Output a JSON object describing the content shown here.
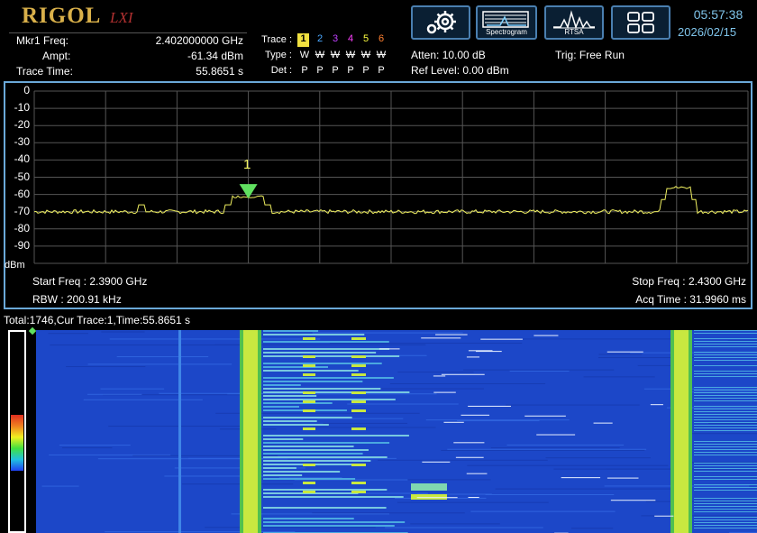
{
  "brand": {
    "logo": "RIGOL",
    "sublogo": "LXI"
  },
  "marker": {
    "freq_label": "Mkr1 Freq:",
    "freq_value": "2.402000000 GHz",
    "ampt_label": "Ampt:",
    "ampt_value": "-61.34 dBm",
    "time_label": "Trace Time:",
    "time_value": "55.8651 s"
  },
  "traces": {
    "trace_label": "Trace :",
    "type_label": "Type :",
    "det_label": "Det :",
    "numbers": [
      "1",
      "2",
      "3",
      "4",
      "5",
      "6"
    ],
    "number_colors": [
      "#000000",
      "#4aa8ff",
      "#c040ff",
      "#ff40ff",
      "#ffff40",
      "#ff8030"
    ],
    "types": [
      "W",
      "W",
      "W",
      "W",
      "W",
      "W"
    ],
    "dets": [
      "P",
      "P",
      "P",
      "P",
      "P",
      "P"
    ]
  },
  "settings": {
    "atten": "Atten: 10.00 dB",
    "ref_level": "Ref Level: 0.00 dBm",
    "trig": "Trig: Free Run"
  },
  "toolbar": {
    "spectrogram_label": "Spectrogram",
    "rtsa_label": "RTSA"
  },
  "clock": {
    "time": "05:57:38",
    "date": "2026/02/15"
  },
  "spectrum": {
    "y_ticks": [
      "0",
      "-10",
      "-20",
      "-30",
      "-40",
      "-50",
      "-60",
      "-70",
      "-80",
      "-90"
    ],
    "y_unit": "dBm",
    "marker_label": "1",
    "start_freq": "Start Freq : 2.3900 GHz",
    "stop_freq": "Stop Freq : 2.4300 GHz",
    "rbw": "RBW : 200.91 kHz",
    "acq_time": "Acq Time : 31.9960 ms",
    "trace_color": "#f0f060"
  },
  "waterfall": {
    "info": "Total:1746,Cur Trace:1,Time:55.8651 s"
  }
}
